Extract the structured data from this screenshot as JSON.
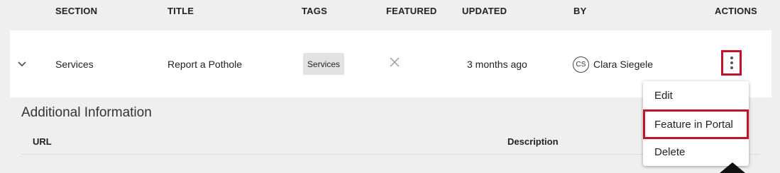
{
  "header": {
    "section": "SECTION",
    "title": "TITLE",
    "tags": "TAGS",
    "featured": "FEATURED",
    "updated": "UPDATED",
    "by": "BY",
    "actions": "ACTIONS"
  },
  "row": {
    "section": "Services",
    "title": "Report a Pothole",
    "tag": "Services",
    "featured_icon": "x-icon",
    "updated": "3 months ago",
    "avatar_initials": "CS",
    "by": "Clara Siegele",
    "actions_icon": "kebab-icon"
  },
  "additional": {
    "title": "Additional Information",
    "col_url": "URL",
    "col_description": "Description"
  },
  "menu": {
    "items": [
      {
        "label": "Edit"
      },
      {
        "label": "Feature in Portal"
      },
      {
        "label": "Delete"
      }
    ]
  },
  "colors": {
    "highlight": "#c0142c",
    "row_bg": "#ffffff",
    "page_bg": "#efefef",
    "tag_bg": "#e2e2e2"
  }
}
